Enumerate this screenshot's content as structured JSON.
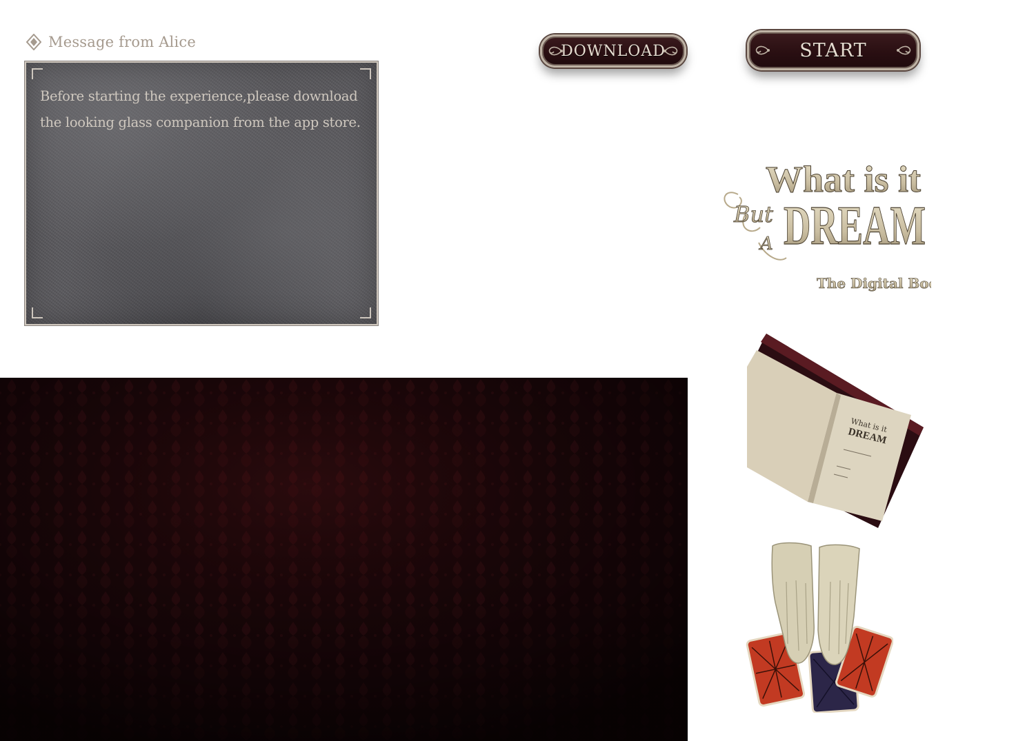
{
  "message": {
    "header": "Message from Alice",
    "body": "Before starting the experience,please download the looking glass companion from the app store.",
    "header_icon": "diamond-icon"
  },
  "buttons": {
    "download_label": "DOWNLOAD",
    "start_label": "START"
  },
  "logo": {
    "line1": "What is it",
    "line2_small": "But",
    "line2_a": "A",
    "line2_big": "DREAM",
    "subtitle": "The Digital Book"
  },
  "book_image": {
    "title_line1": "What is it",
    "title_line2": "DREAM"
  },
  "colors": {
    "panel": "#5a595d",
    "panel_text": "#cfc8bf",
    "plaque": "#2a0f12",
    "plaque_border": "#bfb3a5",
    "damask": "#1a0709",
    "logo_gold": "#c9bda0"
  }
}
